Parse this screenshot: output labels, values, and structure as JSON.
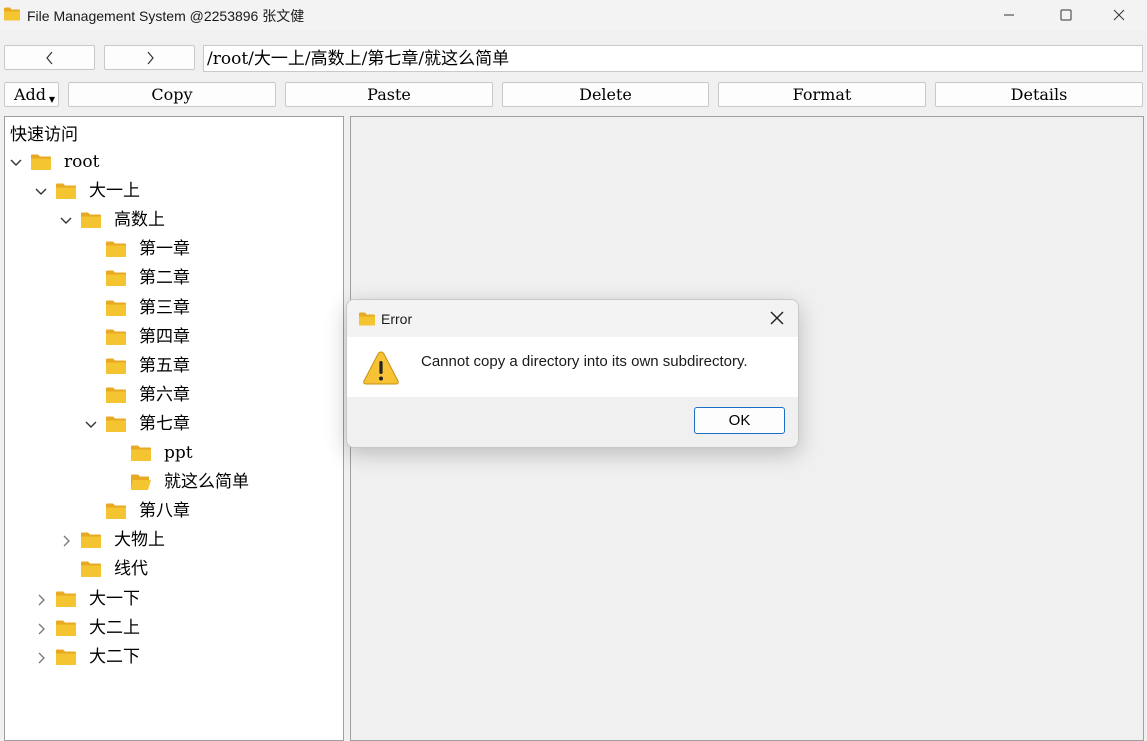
{
  "window": {
    "title": "File Management System @2253896 张文健",
    "controls": [
      "minimize-icon",
      "maximize-icon",
      "close-icon"
    ]
  },
  "navigation": {
    "back_icon": "chevron-left-icon",
    "forward_icon": "chevron-right-icon",
    "path": "/root/大一上/高数上/第七章/就这么简单"
  },
  "toolbar": {
    "add_label": "Add",
    "copy_label": "Copy",
    "paste_label": "Paste",
    "delete_label": "Delete",
    "format_label": "Format",
    "details_label": "Details"
  },
  "tree": {
    "title": "快速访问",
    "nodes": [
      {
        "label": "root",
        "depth": 0,
        "toggle": "expanded"
      },
      {
        "label": "大一上",
        "depth": 1,
        "toggle": "expanded"
      },
      {
        "label": "高数上",
        "depth": 2,
        "toggle": "expanded"
      },
      {
        "label": "第一章",
        "depth": 3,
        "toggle": "none"
      },
      {
        "label": "第二章",
        "depth": 3,
        "toggle": "none"
      },
      {
        "label": "第三章",
        "depth": 3,
        "toggle": "none"
      },
      {
        "label": "第四章",
        "depth": 3,
        "toggle": "none"
      },
      {
        "label": "第五章",
        "depth": 3,
        "toggle": "none"
      },
      {
        "label": "第六章",
        "depth": 3,
        "toggle": "none"
      },
      {
        "label": "第七章",
        "depth": 3,
        "toggle": "expanded"
      },
      {
        "label": "ppt",
        "depth": 4,
        "toggle": "none"
      },
      {
        "label": "就这么简单",
        "depth": 4,
        "toggle": "none",
        "selected": true
      },
      {
        "label": "第八章",
        "depth": 3,
        "toggle": "none"
      },
      {
        "label": "大物上",
        "depth": 2,
        "toggle": "collapsed"
      },
      {
        "label": "线代",
        "depth": 2,
        "toggle": "none"
      },
      {
        "label": "大一下",
        "depth": 1,
        "toggle": "collapsed"
      },
      {
        "label": "大二上",
        "depth": 1,
        "toggle": "collapsed"
      },
      {
        "label": "大二下",
        "depth": 1,
        "toggle": "collapsed"
      }
    ]
  },
  "dialog": {
    "title": "Error",
    "message": "Cannot copy a directory into its own subdirectory.",
    "icon": "warning-icon",
    "ok_label": "OK"
  },
  "colors": {
    "folder": "#f5c431",
    "folder_back": "#e8a923",
    "accent": "#1a6fc4",
    "warning": "#f7c236"
  }
}
